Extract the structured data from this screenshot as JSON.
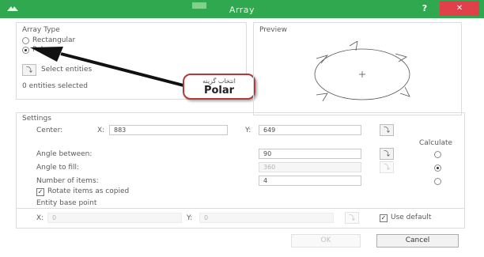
{
  "window": {
    "title": "Array",
    "help": "?",
    "close": "✕"
  },
  "array_type": {
    "label": "Array Type",
    "options": [
      "Rectangular",
      "Polar"
    ],
    "selected": "Polar",
    "select_button_icon": "select-entities-icon",
    "select_label": "Select entities",
    "selected_count": "0 entities selected"
  },
  "preview": {
    "label": "Preview"
  },
  "annotation": {
    "arabic": "انتخاب گزینه",
    "text": "Polar"
  },
  "settings": {
    "label": "Settings",
    "center_label": "Center:",
    "x_label": "X:",
    "x_value": "883",
    "y_label": "Y:",
    "y_value": "649",
    "calculate_label": "Calculate",
    "rows": [
      {
        "label": "Angle between:",
        "value": "90",
        "disabled": false,
        "radio": false
      },
      {
        "label": "Angle to fill:",
        "value": "360",
        "disabled": true,
        "radio": true
      },
      {
        "label": "Number of items:",
        "value": "4",
        "disabled": false,
        "radio": false
      }
    ],
    "rotate_label": "Rotate items as copied",
    "rotate_checked": true
  },
  "base_point": {
    "label": "Entity base point",
    "x_label": "X:",
    "x_value": "0",
    "y_label": "Y:",
    "y_value": "0",
    "use_default_label": "Use default",
    "use_default_checked": true
  },
  "buttons": {
    "ok": "OK",
    "cancel": "Cancel"
  },
  "colors": {
    "titlebar": "#2fa84f",
    "close": "#e0404a",
    "callout_border": "#b33a3a"
  }
}
